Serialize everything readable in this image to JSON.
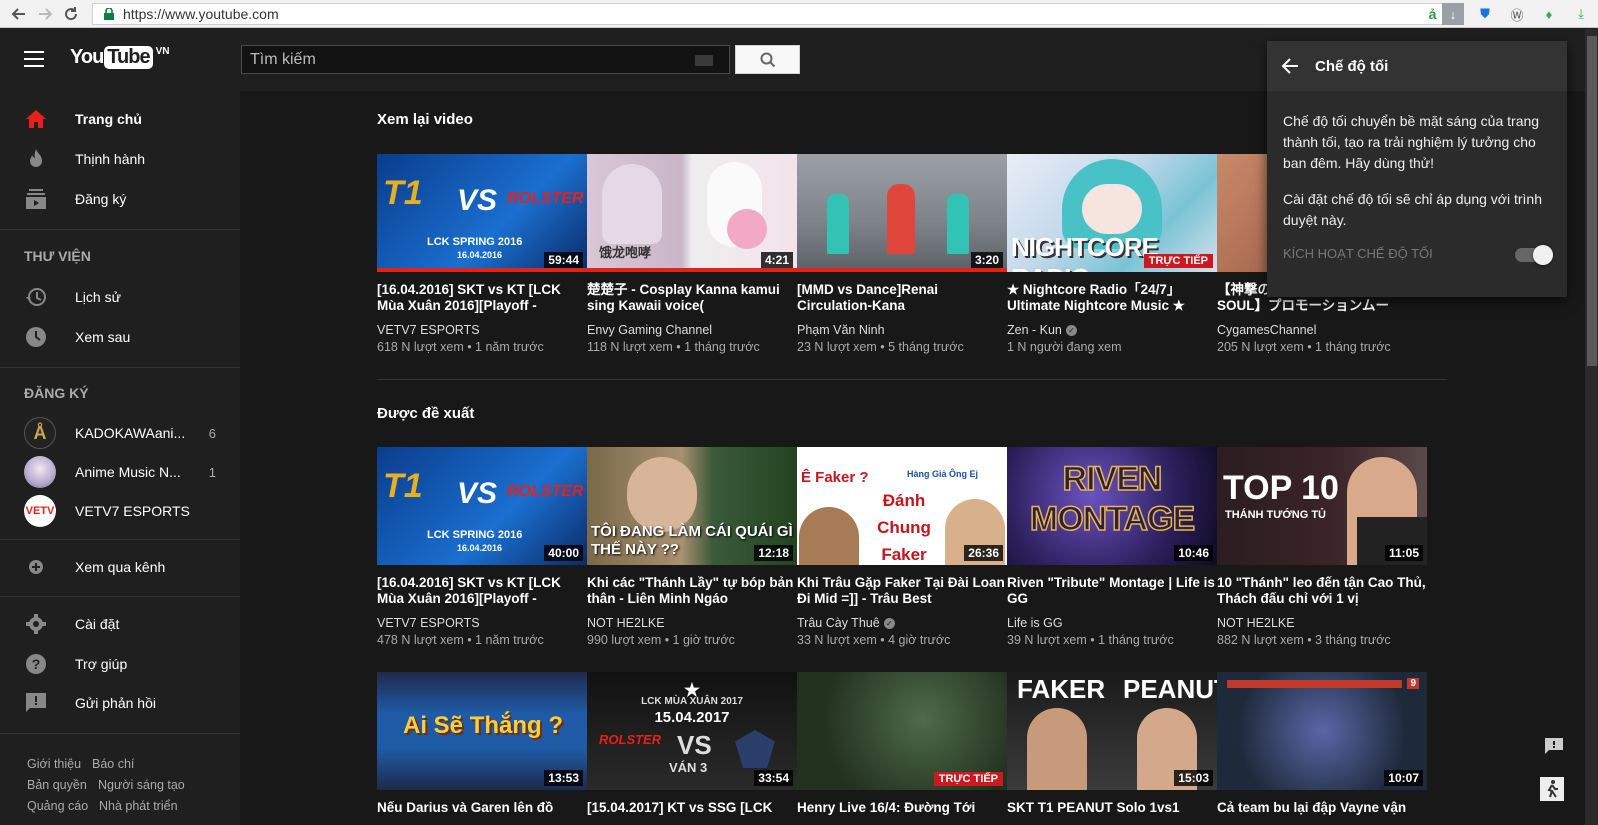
{
  "browser": {
    "url": "https://www.youtube.com"
  },
  "masthead": {
    "logo_you": "You",
    "logo_tube": "Tube",
    "region": "VN",
    "search_placeholder": "Tìm kiếm"
  },
  "sidebar": {
    "main_items": [
      {
        "label": "Trang chủ",
        "icon": "home-icon"
      },
      {
        "label": "Thịnh hành",
        "icon": "flame-icon"
      },
      {
        "label": "Đăng ký",
        "icon": "subscriptions-icon"
      }
    ],
    "library_heading": "THƯ VIỆN",
    "library_items": [
      {
        "label": "Lịch sử",
        "icon": "history-icon"
      },
      {
        "label": "Xem sau",
        "icon": "clock-icon"
      }
    ],
    "subscriptions_heading": "ĐĂNG KÝ",
    "subscriptions": [
      {
        "label": "KADOKAWAani...",
        "count": "6"
      },
      {
        "label": "Anime Music N...",
        "count": "1"
      },
      {
        "label": "VETV7 ESPORTS",
        "count": "",
        "avatar_text": "VETV"
      }
    ],
    "browse_channels": "Xem qua kênh",
    "settings_items": [
      {
        "label": "Cài đặt",
        "icon": "gear-icon"
      },
      {
        "label": "Trợ giúp",
        "icon": "help-icon"
      },
      {
        "label": "Gửi phản hồi",
        "icon": "feedback-icon"
      }
    ],
    "footer_links": [
      "Giới thiệu",
      "Báo chí",
      "Bản quyền",
      "Người sáng tạo",
      "Quảng cáo",
      "Nhà phát triển"
    ]
  },
  "shelves": [
    {
      "title": "Xem lại video",
      "videos": [
        {
          "title": "[16.04.2016] SKT vs KT [LCK Mùa Xuân 2016][Playoff -",
          "channel": "VETV7 ESPORTS",
          "meta": "618 N lượt xem • 1 năm trước",
          "duration": "59:44",
          "thumb_text": "LCK SPRING 2016",
          "thumb_sub": "16.04.2016",
          "watched": 1.0,
          "verified": false
        },
        {
          "title": "楚楚子 - Cosplay Kanna kamui sing Kawaii voice(",
          "channel": "Envy Gaming Channel",
          "meta": "118 N lượt xem • 1 tháng trước",
          "duration": "4:21",
          "thumb_text": "",
          "thumb_sub": "",
          "watched": 1.0,
          "verified": false
        },
        {
          "title": "[MMD vs Dance]Renai Circulation-Kana",
          "channel": "Phạm Văn Ninh",
          "meta": "23 N lượt xem • 5 tháng trước",
          "duration": "3:20",
          "thumb_text": "",
          "thumb_sub": "",
          "watched": 1.0,
          "verified": false
        },
        {
          "title": "★ Nightcore Radio「24/7」 Ultimate Nightcore Music ★",
          "channel": "Zen - Kun",
          "meta": "1 N người đang xem",
          "duration": "",
          "live": "TRỰC TIẾP",
          "thumb_text": "NIGHTCORE RADIO",
          "thumb_sub": "",
          "watched": 0,
          "verified": true
        },
        {
          "title": "【神撃のバハムート VIRGIN SOUL】プロモーションムー",
          "channel": "CygamesChannel",
          "meta": "205 N lượt xem • 1 tháng trước",
          "duration": "",
          "thumb_text": "",
          "thumb_sub": "",
          "watched": 0,
          "verified": false
        }
      ]
    },
    {
      "title": "Được đề xuất",
      "videos": [
        {
          "title": "[16.04.2016] SKT vs KT [LCK Mùa Xuân 2016][Playoff -",
          "channel": "VETV7 ESPORTS",
          "meta": "478 N lượt xem • 1 năm trước",
          "duration": "40:00",
          "thumb_text": "LCK SPRING 2016",
          "thumb_sub": "16.04.2016",
          "watched": 0,
          "verified": false
        },
        {
          "title": "Khi các \"Thánh Lầy\" tự bóp bản thân - Liên Minh Ngáo",
          "channel": "NOT HE2LKE",
          "meta": "990 lượt xem • 1 giờ trước",
          "duration": "12:18",
          "thumb_text": "TÔI ĐANG LÀM CÁI QUÁI GÌ THẾ NÀY ??",
          "thumb_sub": "",
          "watched": 0,
          "verified": false
        },
        {
          "title": "Khi Trâu Gặp Faker Tại Đài Loan Đi Mid =]] - Trâu Best",
          "channel": "Trâu Cày Thuê",
          "meta": "33 N lượt xem • 4 giờ trước",
          "duration": "26:36",
          "thumb_text": "Ê Faker ?",
          "thumb_sub": "Đánh Chung Faker",
          "thumb_extra": "Hàng Giả Ông Ej",
          "watched": 0,
          "verified": true
        },
        {
          "title": "Riven \"Tribute\" Montage | Life is GG",
          "channel": "Life is GG",
          "meta": "39 N lượt xem • 1 tháng trước",
          "duration": "10:46",
          "thumb_text": "RIVEN MONTAGE",
          "thumb_sub": "",
          "watched": 0,
          "verified": false
        },
        {
          "title": "10 \"Thánh\" leo đến tận Cao Thủ, Thách đấu chỉ với 1 vị",
          "channel": "NOT HE2LKE",
          "meta": "882 N lượt xem • 3 tháng trước",
          "duration": "11:05",
          "thumb_text": "TOP 10",
          "thumb_sub": "THÁNH TƯỚNG TỦ",
          "watched": 0,
          "verified": false
        }
      ]
    },
    {
      "title": "",
      "videos": [
        {
          "title": "Nếu Darius và Garen lên đồ",
          "duration": "13:53",
          "thumb_text": "Ai Sẽ Thắng ?",
          "thumb_sub": ""
        },
        {
          "title": "[15.04.2017] KT vs SSG [LCK",
          "duration": "33:54",
          "thumb_text": "LCK MÙA XUÂN 2017",
          "thumb_sub": "15.04.2017",
          "thumb_extra": "VÁN 3"
        },
        {
          "title": "Henry Live 16/4: Đường Tới",
          "duration": "",
          "live": "TRỰC TIẾP",
          "thumb_text": "",
          "thumb_sub": ""
        },
        {
          "title": "SKT T1 PEANUT Solo 1vs1",
          "duration": "15:03",
          "thumb_text": "FAKER",
          "thumb_sub": "PEANUT"
        },
        {
          "title": "Cả team bu lại đập Vayne vận",
          "duration": "10:07",
          "thumb_text": "",
          "thumb_sub": "",
          "badge": "9"
        }
      ]
    }
  ],
  "dark_mode_popup": {
    "title": "Chế độ tối",
    "para1": "Chế độ tối chuyển bề mặt sáng của trang thành tối, tạo ra trải nghiệm lý tưởng cho ban đêm. Hãy dùng thử!",
    "para2": "Cài đặt chế độ tối sẽ chỉ áp dụng với trình duyệt này.",
    "toggle_label": "KÍCH HOẠT CHẾ ĐỘ TỐI",
    "toggle_on": true
  },
  "colors": {
    "accent_red": "#e62117",
    "background": "#181818",
    "sidebar": "#1f1f1f"
  }
}
